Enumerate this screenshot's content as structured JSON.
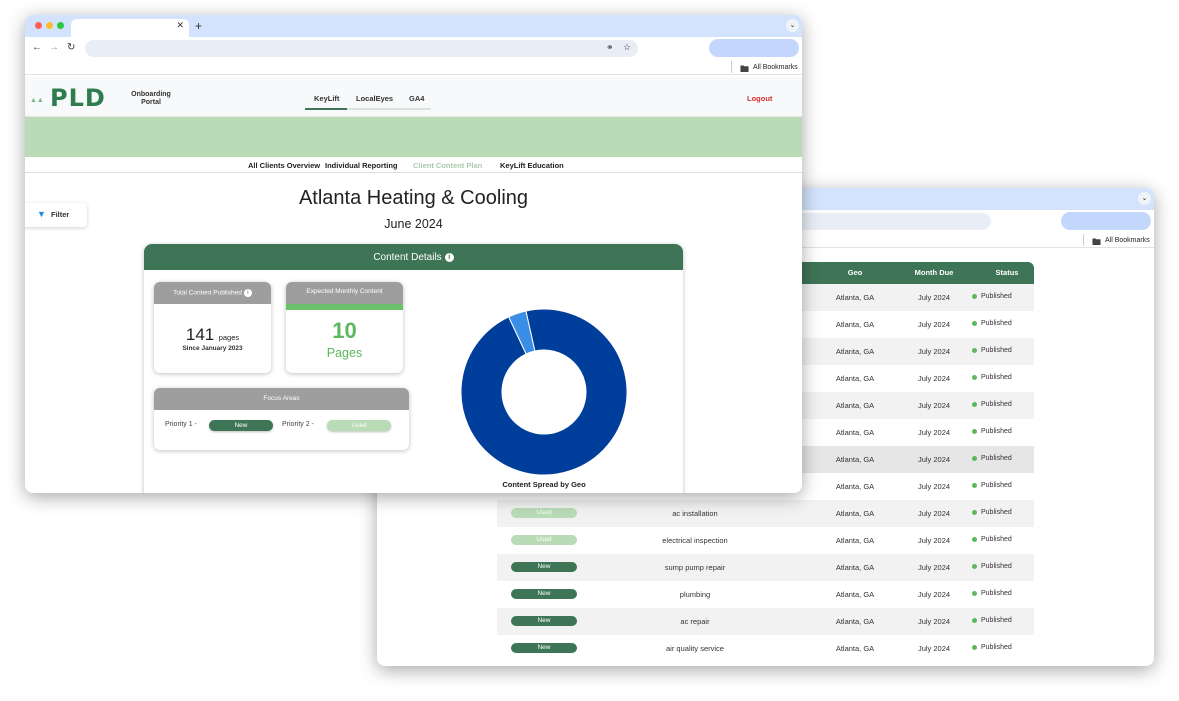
{
  "back_window": {
    "bookmarks_label": "All Bookmarks",
    "table": {
      "headers": {
        "geo": "Geo",
        "month_due": "Month Due",
        "status": "Status"
      },
      "rows": [
        {
          "tag": "",
          "topic": "",
          "geo": "Atlanta, GA",
          "month": "July 2024",
          "status": "Published"
        },
        {
          "tag": "",
          "topic": "",
          "geo": "Atlanta, GA",
          "month": "July 2024",
          "status": "Published"
        },
        {
          "tag": "",
          "topic": "",
          "geo": "Atlanta, GA",
          "month": "July 2024",
          "status": "Published"
        },
        {
          "tag": "",
          "topic": "",
          "geo": "Atlanta, GA",
          "month": "July 2024",
          "status": "Published"
        },
        {
          "tag": "",
          "topic": "",
          "geo": "Atlanta, GA",
          "month": "July 2024",
          "status": "Published"
        },
        {
          "tag": "",
          "topic": "",
          "geo": "Atlanta, GA",
          "month": "July 2024",
          "status": "Published"
        },
        {
          "tag": "",
          "topic": "",
          "geo": "Atlanta, GA",
          "month": "July 2024",
          "status": "Published"
        },
        {
          "tag": "",
          "topic": "",
          "geo": "Atlanta, GA",
          "month": "July 2024",
          "status": "Published"
        },
        {
          "tag": "Used",
          "topic": "ac installation",
          "geo": "Atlanta, GA",
          "month": "July 2024",
          "status": "Published"
        },
        {
          "tag": "Used",
          "topic": "electrical inspection",
          "geo": "Atlanta, GA",
          "month": "July 2024",
          "status": "Published"
        },
        {
          "tag": "New",
          "topic": "sump pump repair",
          "geo": "Atlanta, GA",
          "month": "July 2024",
          "status": "Published"
        },
        {
          "tag": "New",
          "topic": "plumbing",
          "geo": "Atlanta, GA",
          "month": "July 2024",
          "status": "Published"
        },
        {
          "tag": "New",
          "topic": "ac repair",
          "geo": "Atlanta, GA",
          "month": "July 2024",
          "status": "Published"
        },
        {
          "tag": "New",
          "topic": "air quality service",
          "geo": "Atlanta, GA",
          "month": "July 2024",
          "status": "Published"
        }
      ]
    }
  },
  "front_window": {
    "bookmarks_label": "All Bookmarks",
    "app": {
      "logo": "PLD",
      "portal_line1": "Onboarding",
      "portal_line2": "Portal",
      "nav_tabs": [
        "KeyLift",
        "LocalEyes",
        "GA4"
      ],
      "logout": "Logout",
      "sub_tabs": [
        "All Clients Overview",
        "Individual Reporting",
        "Client Content Plan",
        "KeyLift Education"
      ],
      "filter_label": "Filter"
    },
    "page": {
      "title": "Atlanta Heating & Cooling",
      "subtitle": "June 2024"
    },
    "content_details": {
      "title": "Content Details",
      "info_icon": "i",
      "total": {
        "label": "Total Content Published",
        "value": "141",
        "unit": "pages",
        "since": "Since January 2023"
      },
      "expected": {
        "label": "Expected Monthly Content",
        "value": "10",
        "unit": "Pages"
      },
      "focus": {
        "label": "Focus Areas",
        "priority1_label": "Priority 1 -",
        "priority1_value": "New",
        "priority2_label": "Priority 2 -",
        "priority2_value": "Used"
      }
    },
    "colors": {
      "brand_green": "#3e7556",
      "accent_green": "#5cb85c",
      "banner_green": "#b9dbb5",
      "donut_primary": "#003e9c",
      "donut_secondary": "#3a8ee6",
      "logout_red": "#d32f2f"
    }
  },
  "chart_data": {
    "type": "pie",
    "title": "Content Spread by Geo",
    "donut": true,
    "values": [
      96.5,
      3.5
    ]
  }
}
